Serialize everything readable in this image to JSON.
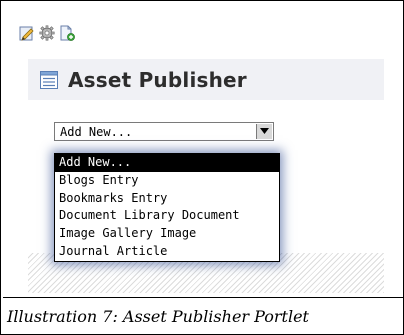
{
  "toolbar": {
    "icons": [
      "edit-icon",
      "gear-icon",
      "add-document-icon"
    ]
  },
  "portlet": {
    "icon": "list-icon",
    "title": "Asset Publisher"
  },
  "select": {
    "value": "Add New...",
    "options": [
      "Add New...",
      "Blogs Entry",
      "Bookmarks Entry",
      "Document Library Document",
      "Image Gallery Image",
      "Journal Article"
    ],
    "selected_index": 0
  },
  "caption": "Illustration 7: Asset Publisher Portlet",
  "colors": {
    "title_bar_bg": "#f0f1f5",
    "selected_option_bg": "#000000",
    "dropdown_glow": "#284a8c"
  }
}
